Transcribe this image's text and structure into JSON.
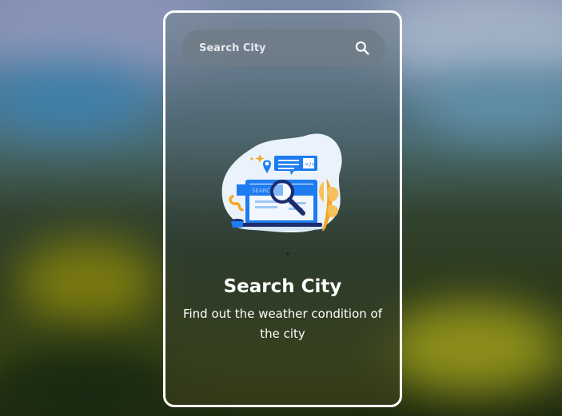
{
  "search": {
    "placeholder": "Search City",
    "icon": "search-icon"
  },
  "empty_state": {
    "illustration": "search-illustration",
    "illustration_search_text": "SEARCH",
    "illustration_code_text": "</>",
    "title": "Search City",
    "subtitle": "Find out the weather condition of the city"
  },
  "colors": {
    "card_border": "#ffffff",
    "text": "#ffffff",
    "illustration_blue": "#1e7cf0",
    "illustration_navy": "#1d2c6e",
    "illustration_orange": "#f5a623"
  }
}
